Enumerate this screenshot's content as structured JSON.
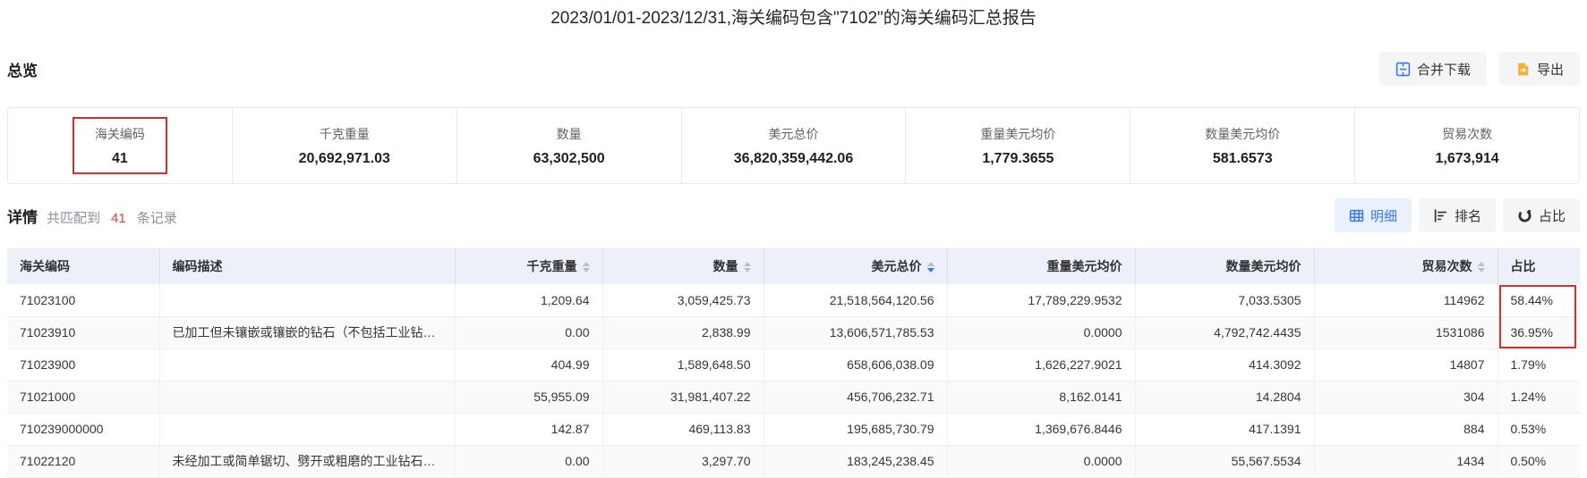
{
  "page": {
    "title": "2023/01/01-2023/12/31,海关编码包含\"7102\"的海关编码汇总报告"
  },
  "colors": {
    "accent_blue": "#3876f6",
    "export_orange": "#f7af3c",
    "annotation_red": "#e02b2b",
    "count_red": "#f03e3e",
    "table_header_bg": "#edf0f9"
  },
  "overview": {
    "heading": "总览",
    "buttons": {
      "merge_download": "合并下载",
      "export": "导出"
    },
    "stats": [
      {
        "label": "海关编码",
        "value": "41",
        "highlighted": true
      },
      {
        "label": "千克重量",
        "value": "20,692,971.03"
      },
      {
        "label": "数量",
        "value": "63,302,500"
      },
      {
        "label": "美元总价",
        "value": "36,820,359,442.06"
      },
      {
        "label": "重量美元均价",
        "value": "1,779.3655"
      },
      {
        "label": "数量美元均价",
        "value": "581.6573"
      },
      {
        "label": "贸易次数",
        "value": "1,673,914"
      }
    ]
  },
  "details": {
    "heading": "详情",
    "match_prefix": "共匹配到",
    "match_count": "41",
    "match_suffix": "条记录",
    "view_buttons": [
      {
        "label": "明细",
        "icon": "table-grid-icon",
        "active": true
      },
      {
        "label": "排名",
        "icon": "ranking-bars-icon",
        "active": false
      },
      {
        "label": "占比",
        "icon": "donut-chart-icon",
        "active": false
      }
    ]
  },
  "table": {
    "columns": [
      {
        "label": "海关编码",
        "sortable": false,
        "align": "left"
      },
      {
        "label": "编码描述",
        "sortable": false,
        "align": "left"
      },
      {
        "label": "千克重量",
        "sortable": true,
        "sort": null,
        "align": "right"
      },
      {
        "label": "数量",
        "sortable": true,
        "sort": null,
        "align": "right"
      },
      {
        "label": "美元总价",
        "sortable": true,
        "sort": "desc",
        "align": "right"
      },
      {
        "label": "重量美元均价",
        "sortable": false,
        "align": "right"
      },
      {
        "label": "数量美元均价",
        "sortable": false,
        "align": "right"
      },
      {
        "label": "贸易次数",
        "sortable": true,
        "sort": null,
        "align": "right"
      },
      {
        "label": "占比",
        "sortable": false,
        "align": "left"
      }
    ],
    "rows": [
      [
        "71023100",
        "",
        "1,209.64",
        "3,059,425.73",
        "21,518,564,120.56",
        "17,789,229.9532",
        "7,033.5305",
        "114962",
        "58.44%"
      ],
      [
        "71023910",
        "已加工但未镶嵌或镶嵌的钻石（不包括工业钻石...",
        "0.00",
        "2,838.99",
        "13,606,571,785.53",
        "0.0000",
        "4,792,742.4435",
        "1531086",
        "36.95%"
      ],
      [
        "71023900",
        "",
        "404.99",
        "1,589,648.50",
        "658,606,038.09",
        "1,626,227.9021",
        "414.3092",
        "14807",
        "1.79%"
      ],
      [
        "71021000",
        "",
        "55,955.09",
        "31,981,407.22",
        "456,706,232.71",
        "8,162.0141",
        "14.2804",
        "304",
        "1.24%"
      ],
      [
        "710239000000",
        "",
        "142.87",
        "469,113.83",
        "195,685,730.79",
        "1,369,676.8446",
        "417.1391",
        "884",
        "0.53%"
      ],
      [
        "71022120",
        "未经加工或简单锯切、劈开或粗磨的工业钻石：...",
        "0.00",
        "3,297.70",
        "183,245,238.45",
        "0.0000",
        "55,567.5534",
        "1434",
        "0.50%"
      ]
    ]
  }
}
